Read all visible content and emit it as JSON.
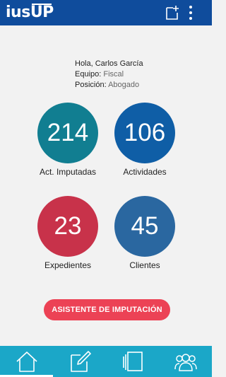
{
  "app": {
    "logo_text_a": "ius",
    "logo_text_b": "UP"
  },
  "header": {
    "icons": [
      "new-note-icon",
      "more-vert-icon"
    ]
  },
  "greeting": {
    "hello": "Hola, Carlos García",
    "team_label": "Equipo:",
    "team_value": "Fiscal",
    "position_label": "Posición:",
    "position_value": "Abogado"
  },
  "stats": [
    {
      "value": "214",
      "label": "Act. Imputadas",
      "color": "#117e91"
    },
    {
      "value": "106",
      "label": "Actividades",
      "color": "#0f5ea6"
    },
    {
      "value": "23",
      "label": "Expedientes",
      "color": "#c8324a"
    },
    {
      "value": "45",
      "label": "Clientes",
      "color": "#2a67a0"
    }
  ],
  "cta": {
    "label": "ASISTENTE DE IMPUTACIÓN"
  },
  "nav": {
    "items": [
      "home-icon",
      "edit-icon",
      "files-icon",
      "users-icon"
    ],
    "active": "home-icon"
  },
  "colors": {
    "header": "#0f4c9c",
    "bottom_bar": "#1ba7c8",
    "cta": "#ec4255"
  }
}
